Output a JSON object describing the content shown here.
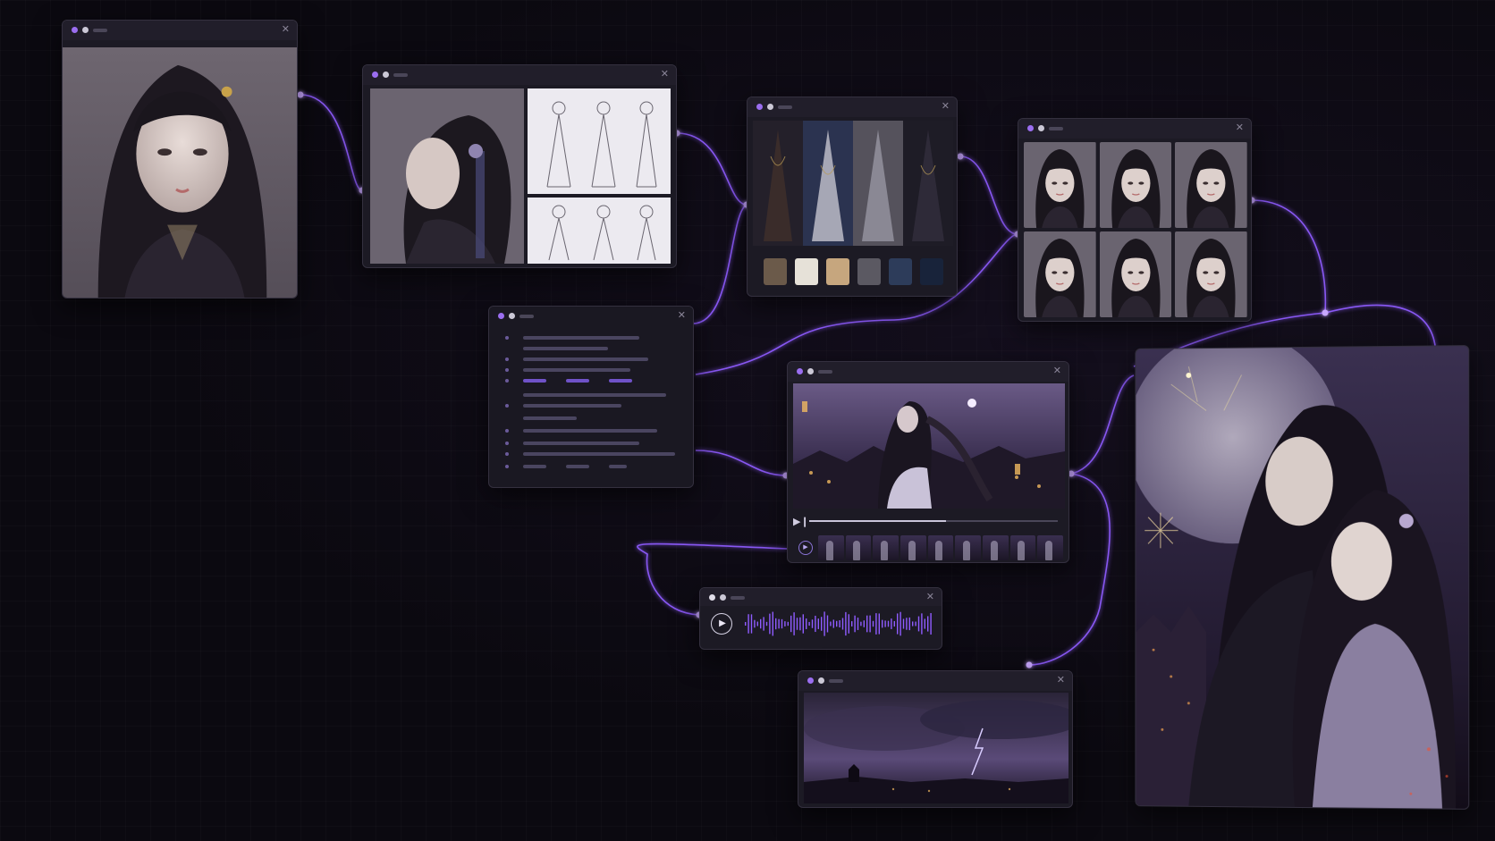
{
  "canvas": {
    "accent_color": "#8f5cff",
    "node_glow_color": "#c9a8ff",
    "background_color": "#0b0910"
  },
  "windows": {
    "portrait": {
      "close_icon": "✕"
    },
    "turnaround": {
      "close_icon": "✕"
    },
    "costume": {
      "close_icon": "✕",
      "swatches": [
        "#6b5a4a",
        "#e6e1d8",
        "#c6a67e",
        "#5b5962",
        "#2d3c5a",
        "#18233a"
      ]
    },
    "expressions": {
      "close_icon": "✕",
      "tile_count": 6
    },
    "script": {
      "close_icon": "✕"
    },
    "video": {
      "close_icon": "✕",
      "play_glyph": "▶❙",
      "timeline_play_glyph": "▶",
      "progress": 0.55
    },
    "audio": {
      "close_icon": "✕",
      "play_glyph": "▶"
    },
    "storm": {
      "close_icon": "✕"
    },
    "poster": {}
  }
}
